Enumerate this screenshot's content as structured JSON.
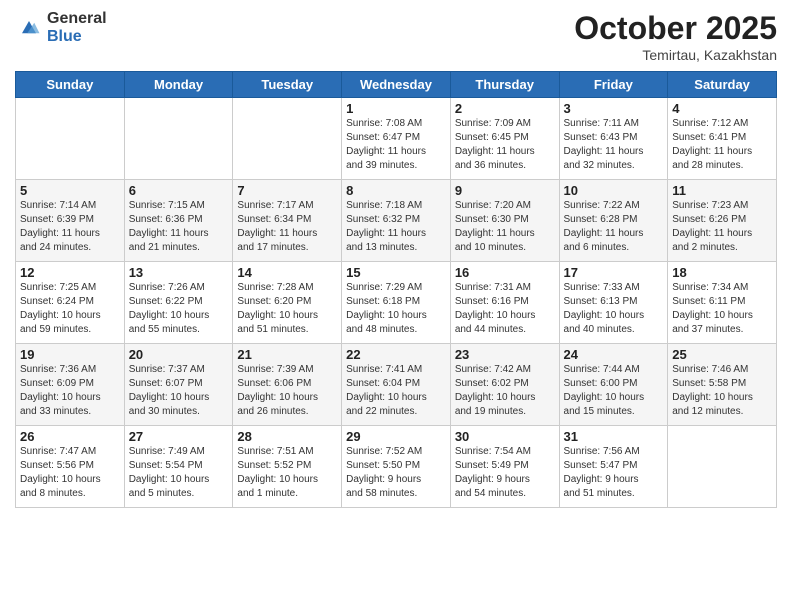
{
  "header": {
    "logo_general": "General",
    "logo_blue": "Blue",
    "month_title": "October 2025",
    "location": "Temirtau, Kazakhstan"
  },
  "weekdays": [
    "Sunday",
    "Monday",
    "Tuesday",
    "Wednesday",
    "Thursday",
    "Friday",
    "Saturday"
  ],
  "weeks": [
    [
      {
        "day": "",
        "info": ""
      },
      {
        "day": "",
        "info": ""
      },
      {
        "day": "",
        "info": ""
      },
      {
        "day": "1",
        "info": "Sunrise: 7:08 AM\nSunset: 6:47 PM\nDaylight: 11 hours\nand 39 minutes."
      },
      {
        "day": "2",
        "info": "Sunrise: 7:09 AM\nSunset: 6:45 PM\nDaylight: 11 hours\nand 36 minutes."
      },
      {
        "day": "3",
        "info": "Sunrise: 7:11 AM\nSunset: 6:43 PM\nDaylight: 11 hours\nand 32 minutes."
      },
      {
        "day": "4",
        "info": "Sunrise: 7:12 AM\nSunset: 6:41 PM\nDaylight: 11 hours\nand 28 minutes."
      }
    ],
    [
      {
        "day": "5",
        "info": "Sunrise: 7:14 AM\nSunset: 6:39 PM\nDaylight: 11 hours\nand 24 minutes."
      },
      {
        "day": "6",
        "info": "Sunrise: 7:15 AM\nSunset: 6:36 PM\nDaylight: 11 hours\nand 21 minutes."
      },
      {
        "day": "7",
        "info": "Sunrise: 7:17 AM\nSunset: 6:34 PM\nDaylight: 11 hours\nand 17 minutes."
      },
      {
        "day": "8",
        "info": "Sunrise: 7:18 AM\nSunset: 6:32 PM\nDaylight: 11 hours\nand 13 minutes."
      },
      {
        "day": "9",
        "info": "Sunrise: 7:20 AM\nSunset: 6:30 PM\nDaylight: 11 hours\nand 10 minutes."
      },
      {
        "day": "10",
        "info": "Sunrise: 7:22 AM\nSunset: 6:28 PM\nDaylight: 11 hours\nand 6 minutes."
      },
      {
        "day": "11",
        "info": "Sunrise: 7:23 AM\nSunset: 6:26 PM\nDaylight: 11 hours\nand 2 minutes."
      }
    ],
    [
      {
        "day": "12",
        "info": "Sunrise: 7:25 AM\nSunset: 6:24 PM\nDaylight: 10 hours\nand 59 minutes."
      },
      {
        "day": "13",
        "info": "Sunrise: 7:26 AM\nSunset: 6:22 PM\nDaylight: 10 hours\nand 55 minutes."
      },
      {
        "day": "14",
        "info": "Sunrise: 7:28 AM\nSunset: 6:20 PM\nDaylight: 10 hours\nand 51 minutes."
      },
      {
        "day": "15",
        "info": "Sunrise: 7:29 AM\nSunset: 6:18 PM\nDaylight: 10 hours\nand 48 minutes."
      },
      {
        "day": "16",
        "info": "Sunrise: 7:31 AM\nSunset: 6:16 PM\nDaylight: 10 hours\nand 44 minutes."
      },
      {
        "day": "17",
        "info": "Sunrise: 7:33 AM\nSunset: 6:13 PM\nDaylight: 10 hours\nand 40 minutes."
      },
      {
        "day": "18",
        "info": "Sunrise: 7:34 AM\nSunset: 6:11 PM\nDaylight: 10 hours\nand 37 minutes."
      }
    ],
    [
      {
        "day": "19",
        "info": "Sunrise: 7:36 AM\nSunset: 6:09 PM\nDaylight: 10 hours\nand 33 minutes."
      },
      {
        "day": "20",
        "info": "Sunrise: 7:37 AM\nSunset: 6:07 PM\nDaylight: 10 hours\nand 30 minutes."
      },
      {
        "day": "21",
        "info": "Sunrise: 7:39 AM\nSunset: 6:06 PM\nDaylight: 10 hours\nand 26 minutes."
      },
      {
        "day": "22",
        "info": "Sunrise: 7:41 AM\nSunset: 6:04 PM\nDaylight: 10 hours\nand 22 minutes."
      },
      {
        "day": "23",
        "info": "Sunrise: 7:42 AM\nSunset: 6:02 PM\nDaylight: 10 hours\nand 19 minutes."
      },
      {
        "day": "24",
        "info": "Sunrise: 7:44 AM\nSunset: 6:00 PM\nDaylight: 10 hours\nand 15 minutes."
      },
      {
        "day": "25",
        "info": "Sunrise: 7:46 AM\nSunset: 5:58 PM\nDaylight: 10 hours\nand 12 minutes."
      }
    ],
    [
      {
        "day": "26",
        "info": "Sunrise: 7:47 AM\nSunset: 5:56 PM\nDaylight: 10 hours\nand 8 minutes."
      },
      {
        "day": "27",
        "info": "Sunrise: 7:49 AM\nSunset: 5:54 PM\nDaylight: 10 hours\nand 5 minutes."
      },
      {
        "day": "28",
        "info": "Sunrise: 7:51 AM\nSunset: 5:52 PM\nDaylight: 10 hours\nand 1 minute."
      },
      {
        "day": "29",
        "info": "Sunrise: 7:52 AM\nSunset: 5:50 PM\nDaylight: 9 hours\nand 58 minutes."
      },
      {
        "day": "30",
        "info": "Sunrise: 7:54 AM\nSunset: 5:49 PM\nDaylight: 9 hours\nand 54 minutes."
      },
      {
        "day": "31",
        "info": "Sunrise: 7:56 AM\nSunset: 5:47 PM\nDaylight: 9 hours\nand 51 minutes."
      },
      {
        "day": "",
        "info": ""
      }
    ]
  ]
}
